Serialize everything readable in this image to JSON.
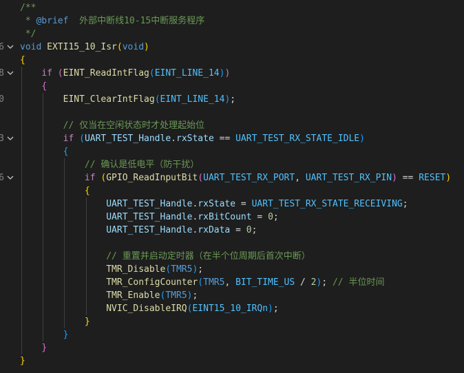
{
  "line_numbers": [
    "",
    "",
    "",
    "6",
    "",
    "8",
    "",
    "0",
    "",
    "",
    "3",
    "",
    "",
    "6",
    "",
    "",
    "",
    "",
    "",
    "",
    "",
    "",
    "",
    "",
    "",
    "",
    "",
    ""
  ],
  "lines": [
    {
      "parts": [
        {
          "t": "/**",
          "c": "cmt"
        }
      ]
    },
    {
      "parts": [
        {
          "t": " * ",
          "c": "cmt"
        },
        {
          "t": "@brief",
          "c": "doc"
        },
        {
          "t": "  外部中断线10-15中断服务程序",
          "c": "cmt"
        }
      ]
    },
    {
      "parts": [
        {
          "t": " */",
          "c": "cmt"
        }
      ]
    },
    {
      "parts": [
        {
          "t": "void",
          "c": "kw"
        },
        {
          "t": " ",
          "c": "pun"
        },
        {
          "t": "EXTI15_10_Isr",
          "c": "fn"
        },
        {
          "t": "(",
          "c": "br1"
        },
        {
          "t": "void",
          "c": "kw"
        },
        {
          "t": ")",
          "c": "br1"
        }
      ]
    },
    {
      "parts": [
        {
          "t": "{",
          "c": "br1"
        }
      ]
    },
    {
      "parts": [
        {
          "t": "    ",
          "c": "pun"
        },
        {
          "t": "if",
          "c": "kw2"
        },
        {
          "t": " ",
          "c": "pun"
        },
        {
          "t": "(",
          "c": "br2"
        },
        {
          "t": "EINT_ReadIntFlag",
          "c": "fn"
        },
        {
          "t": "(",
          "c": "br3"
        },
        {
          "t": "EINT_LINE_14",
          "c": "mac"
        },
        {
          "t": ")",
          "c": "br3"
        },
        {
          "t": ")",
          "c": "br2"
        }
      ]
    },
    {
      "parts": [
        {
          "t": "    ",
          "c": "pun"
        },
        {
          "t": "{",
          "c": "br2"
        }
      ]
    },
    {
      "parts": [
        {
          "t": "        ",
          "c": "pun"
        },
        {
          "t": "EINT_ClearIntFlag",
          "c": "fn"
        },
        {
          "t": "(",
          "c": "br3"
        },
        {
          "t": "EINT_LINE_14",
          "c": "mac"
        },
        {
          "t": ")",
          "c": "br3"
        },
        {
          "t": ";",
          "c": "pun"
        }
      ]
    },
    {
      "parts": []
    },
    {
      "parts": [
        {
          "t": "        ",
          "c": "pun"
        },
        {
          "t": "// 仅当在空闲状态时才处理起始位",
          "c": "cmt"
        }
      ]
    },
    {
      "parts": [
        {
          "t": "        ",
          "c": "pun"
        },
        {
          "t": "if",
          "c": "kw2"
        },
        {
          "t": " ",
          "c": "pun"
        },
        {
          "t": "(",
          "c": "br3"
        },
        {
          "t": "UART_TEST_Handle",
          "c": "var"
        },
        {
          "t": ".",
          "c": "pun"
        },
        {
          "t": "rxState",
          "c": "var"
        },
        {
          "t": " == ",
          "c": "pun"
        },
        {
          "t": "UART_TEST_RX_STATE_IDLE",
          "c": "mac"
        },
        {
          "t": ")",
          "c": "br3"
        }
      ]
    },
    {
      "parts": [
        {
          "t": "        ",
          "c": "pun"
        },
        {
          "t": "{",
          "c": "br3"
        }
      ]
    },
    {
      "parts": [
        {
          "t": "            ",
          "c": "pun"
        },
        {
          "t": "// 确认是低电平（防干扰）",
          "c": "cmt"
        }
      ]
    },
    {
      "parts": [
        {
          "t": "            ",
          "c": "pun"
        },
        {
          "t": "if",
          "c": "kw2"
        },
        {
          "t": " ",
          "c": "pun"
        },
        {
          "t": "(",
          "c": "br1"
        },
        {
          "t": "GPIO_ReadInputBit",
          "c": "fn"
        },
        {
          "t": "(",
          "c": "br2"
        },
        {
          "t": "UART_TEST_RX_PORT",
          "c": "mac"
        },
        {
          "t": ", ",
          "c": "pun"
        },
        {
          "t": "UART_TEST_RX_PIN",
          "c": "mac"
        },
        {
          "t": ")",
          "c": "br2"
        },
        {
          "t": " == ",
          "c": "pun"
        },
        {
          "t": "RESET",
          "c": "mac"
        },
        {
          "t": ")",
          "c": "br1"
        }
      ]
    },
    {
      "parts": [
        {
          "t": "            ",
          "c": "pun"
        },
        {
          "t": "{",
          "c": "br1"
        }
      ]
    },
    {
      "parts": [
        {
          "t": "                ",
          "c": "pun"
        },
        {
          "t": "UART_TEST_Handle",
          "c": "var"
        },
        {
          "t": ".",
          "c": "pun"
        },
        {
          "t": "rxState",
          "c": "var"
        },
        {
          "t": " = ",
          "c": "pun"
        },
        {
          "t": "UART_TEST_RX_STATE_RECEIVING",
          "c": "mac"
        },
        {
          "t": ";",
          "c": "pun"
        }
      ]
    },
    {
      "parts": [
        {
          "t": "                ",
          "c": "pun"
        },
        {
          "t": "UART_TEST_Handle",
          "c": "var"
        },
        {
          "t": ".",
          "c": "pun"
        },
        {
          "t": "rxBitCount",
          "c": "var"
        },
        {
          "t": " = ",
          "c": "pun"
        },
        {
          "t": "0",
          "c": "num"
        },
        {
          "t": ";",
          "c": "pun"
        }
      ]
    },
    {
      "parts": [
        {
          "t": "                ",
          "c": "pun"
        },
        {
          "t": "UART_TEST_Handle",
          "c": "var"
        },
        {
          "t": ".",
          "c": "pun"
        },
        {
          "t": "rxData",
          "c": "var"
        },
        {
          "t": " = ",
          "c": "pun"
        },
        {
          "t": "0",
          "c": "num"
        },
        {
          "t": ";",
          "c": "pun"
        }
      ]
    },
    {
      "parts": []
    },
    {
      "parts": [
        {
          "t": "                ",
          "c": "pun"
        },
        {
          "t": "// 重置并启动定时器（在半个位周期后首次中断）",
          "c": "cmt"
        }
      ]
    },
    {
      "parts": [
        {
          "t": "                ",
          "c": "pun"
        },
        {
          "t": "TMR_Disable",
          "c": "fn"
        },
        {
          "t": "(",
          "c": "br3"
        },
        {
          "t": "TMR5",
          "c": "mac2"
        },
        {
          "t": ")",
          "c": "br3"
        },
        {
          "t": ";",
          "c": "pun"
        }
      ]
    },
    {
      "parts": [
        {
          "t": "                ",
          "c": "pun"
        },
        {
          "t": "TMR_ConfigCounter",
          "c": "fn"
        },
        {
          "t": "(",
          "c": "br3"
        },
        {
          "t": "TMR5",
          "c": "mac2"
        },
        {
          "t": ", ",
          "c": "pun"
        },
        {
          "t": "BIT_TIME_US",
          "c": "mac"
        },
        {
          "t": " / ",
          "c": "pun"
        },
        {
          "t": "2",
          "c": "num"
        },
        {
          "t": ")",
          "c": "br3"
        },
        {
          "t": "; ",
          "c": "pun"
        },
        {
          "t": "// 半位时间",
          "c": "cmt"
        }
      ]
    },
    {
      "parts": [
        {
          "t": "                ",
          "c": "pun"
        },
        {
          "t": "TMR_Enable",
          "c": "fn"
        },
        {
          "t": "(",
          "c": "br3"
        },
        {
          "t": "TMR5",
          "c": "mac2"
        },
        {
          "t": ")",
          "c": "br3"
        },
        {
          "t": ";",
          "c": "pun"
        }
      ]
    },
    {
      "parts": [
        {
          "t": "                ",
          "c": "pun"
        },
        {
          "t": "NVIC_DisableIRQ",
          "c": "fn"
        },
        {
          "t": "(",
          "c": "br3"
        },
        {
          "t": "EINT15_10_IRQn",
          "c": "mac"
        },
        {
          "t": ")",
          "c": "br3"
        },
        {
          "t": ";",
          "c": "pun"
        }
      ]
    },
    {
      "parts": [
        {
          "t": "            ",
          "c": "pun"
        },
        {
          "t": "}",
          "c": "br1"
        }
      ]
    },
    {
      "parts": [
        {
          "t": "        ",
          "c": "pun"
        },
        {
          "t": "}",
          "c": "br3"
        }
      ]
    },
    {
      "parts": [
        {
          "t": "    ",
          "c": "pun"
        },
        {
          "t": "}",
          "c": "br2"
        }
      ]
    },
    {
      "parts": [
        {
          "t": "}",
          "c": "br1"
        }
      ]
    }
  ],
  "fold_markers": [
    3,
    5,
    10,
    13
  ]
}
